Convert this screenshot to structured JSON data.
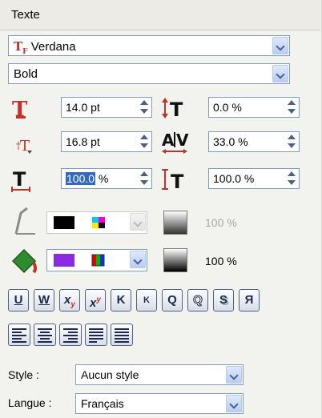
{
  "panel": {
    "title": "Texte"
  },
  "font": {
    "family": "Verdana",
    "style": "Bold",
    "font_icon_glyph": "T",
    "font_icon_sub": "F"
  },
  "metrics": {
    "size": "14.0 pt",
    "baseline_shift": "0.0 %",
    "leading": "16.8 pt",
    "kerning": "33.0 %",
    "horizontal_scale_number": "100.0",
    "horizontal_scale_unit": " %",
    "vertical_scale": "100.0 %"
  },
  "stroke": {
    "percent": "100 %",
    "color": "#000000"
  },
  "fill": {
    "percent": "100 %",
    "color": "#8a2be2"
  },
  "format_buttons": [
    "U",
    "W",
    "x",
    "x",
    "K",
    "K",
    "Q",
    "Q",
    "S",
    "Я"
  ],
  "align_buttons": [
    "align-left-icon",
    "align-center-icon",
    "align-right-icon",
    "justify-left-icon",
    "justify-all-icon"
  ],
  "style": {
    "label": "Style :",
    "value": "Aucun style"
  },
  "language": {
    "label": "Langue :",
    "value": "Français"
  }
}
